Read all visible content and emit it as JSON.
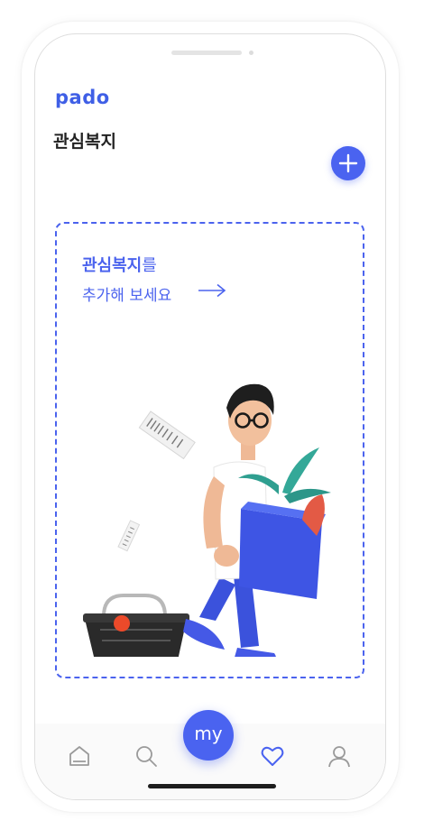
{
  "app": {
    "logo": "pado"
  },
  "header": {
    "title": "관심복지"
  },
  "empty_state": {
    "line1_bold": "관심복지",
    "line1_rest": "를",
    "line2": "추가해 보세요"
  },
  "nav": {
    "center_label": "my",
    "items": [
      "home-icon",
      "search-icon",
      "my-button",
      "heart-icon",
      "user-icon"
    ],
    "active": "heart-icon"
  },
  "colors": {
    "accent": "#4a63f0",
    "accent_text": "#4b63ee",
    "title": "#222222",
    "nav_inactive": "#9a9a9a"
  }
}
